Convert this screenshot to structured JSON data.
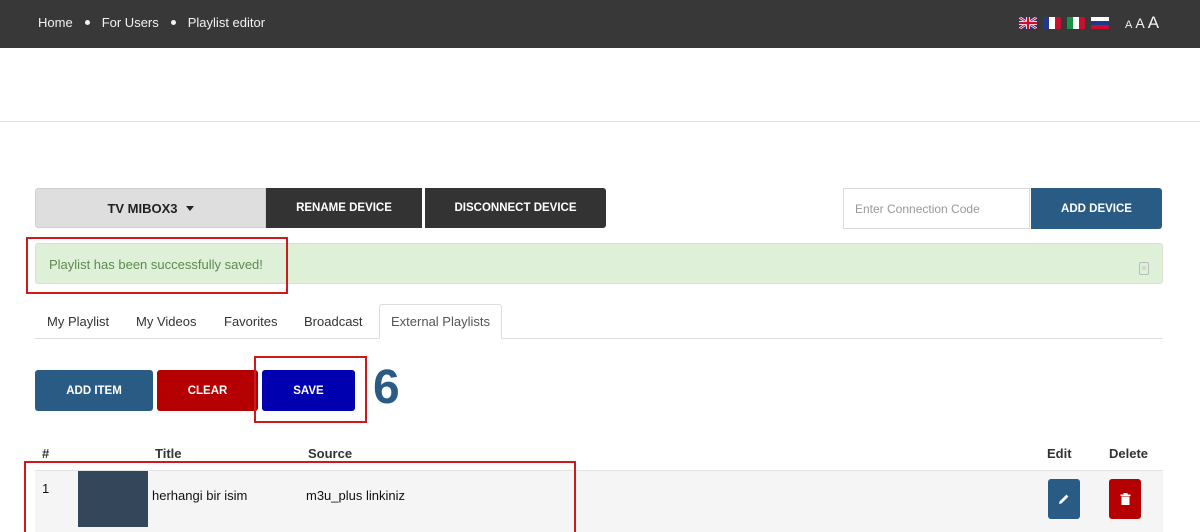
{
  "breadcrumb": {
    "items": [
      "Home",
      "For Users",
      "Playlist editor"
    ]
  },
  "languages": [
    "english-flag-icon",
    "french-flag-icon",
    "italian-flag-icon",
    "russian-flag-icon"
  ],
  "font_size_controls": [
    "A",
    "A",
    "A"
  ],
  "device": {
    "selected": "TV MIBOX3",
    "rename_label": "RENAME DEVICE",
    "disconnect_label": "DISCONNECT DEVICE",
    "connection_placeholder": "Enter Connection Code",
    "add_device_label": "ADD DEVICE"
  },
  "alert": {
    "message": "Playlist has been successfully saved!"
  },
  "tabs": [
    {
      "label": "My Playlist",
      "active": false
    },
    {
      "label": "My Videos",
      "active": false
    },
    {
      "label": "Favorites",
      "active": false
    },
    {
      "label": "Broadcast",
      "active": false
    },
    {
      "label": "External Playlists",
      "active": true
    }
  ],
  "actions": {
    "add_item": "ADD ITEM",
    "clear": "CLEAR",
    "save": "SAVE"
  },
  "step_number": "6",
  "table": {
    "headers": {
      "index": "#",
      "title": "Title",
      "source": "Source",
      "edit": "Edit",
      "delete": "Delete"
    },
    "rows": [
      {
        "index": "1",
        "title": "herhangi bir isim",
        "source": "m3u_plus linkiniz"
      }
    ]
  },
  "colors": {
    "topbar": "#383838",
    "primary": "#2a5b84",
    "danger": "#b40000",
    "save": "#0000b0",
    "success_bg": "#dff0d8",
    "highlight": "#d0191f"
  }
}
